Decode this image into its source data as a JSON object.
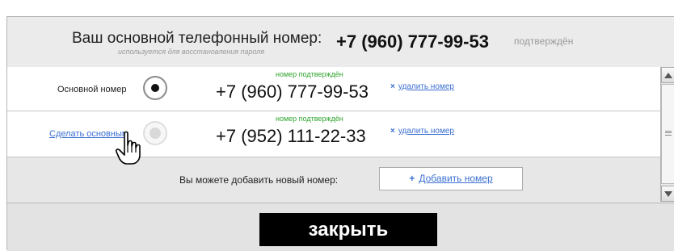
{
  "header": {
    "title": "Ваш основной телефонный номер:",
    "hint": "используется для восстановления пароля",
    "number": "+7 (960) 777-99-53",
    "status": "подтверждён"
  },
  "phones": [
    {
      "label": "Основной номер",
      "status": "номер подтверждён",
      "number": "+7 (960) 777-99-53",
      "delete_label": "удалить номер",
      "selected": true
    },
    {
      "label": "Сделать основным",
      "status": "номер подтверждён",
      "number": "+7 (952) 111-22-33",
      "delete_label": "удалить номер",
      "selected": false
    }
  ],
  "add": {
    "text": "Вы можете добавить новый номер:",
    "button_label": "Добавить номер",
    "button_icon": "plus-icon"
  },
  "delete_icon": "x-icon",
  "cursor_icon": "hand-pointer-icon",
  "footer": {
    "close_label": "закрыть"
  },
  "colors": {
    "link": "#3b6fd1",
    "confirmed": "#2fa52f",
    "close_bg": "#000000"
  }
}
